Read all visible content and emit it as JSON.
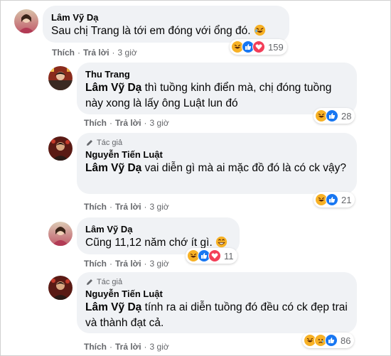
{
  "comments": [
    {
      "name": "Lâm Vỹ Dạ",
      "text": "Sau chị Trang là tới em đóng với ổng đó.",
      "like": "Thích",
      "reply": "Trả lời",
      "time": "3 giờ",
      "reaction_count": "159"
    },
    {
      "name": "Thu Trang",
      "tag": "Lâm Vỹ Dạ",
      "text": " thì tuồng kinh điển mà, chị đóng tuồng này xong là lấy ông Luật lun đó",
      "like": "Thích",
      "reply": "Trả lời",
      "time": "3 giờ",
      "reaction_count": "28"
    },
    {
      "badge": "Tác giả",
      "name": "Nguyễn Tiến Luật",
      "tag": "Lâm Vỹ Dạ",
      "text": " vai diễn gì mà ai mặc đồ đó là có ck vậy?",
      "like": "Thích",
      "reply": "Trả lời",
      "time": "3 giờ",
      "reaction_count": "21"
    },
    {
      "name": "Lâm Vỹ Dạ",
      "text": "Cũng 11,12 năm chớ ít gì.",
      "like": "Thích",
      "reply": "Trả lời",
      "time": "3 giờ",
      "reaction_count": "11"
    },
    {
      "badge": "Tác giả",
      "name": "Nguyễn Tiến Luật",
      "tag": "Lâm Vỹ Dạ",
      "text": " tính ra ai diễn tuồng đó đều có ck đẹp trai và thành đạt cả.",
      "like": "Thích",
      "reply": "Trả lời",
      "time": "3 giờ",
      "reaction_count": "86"
    }
  ],
  "colors": {
    "bubble": "#f0f2f5",
    "like_blue": "#1877f2",
    "love_red": "#f33e58",
    "haha_yellow": "#f7b125",
    "meta_gray": "#65676b"
  }
}
